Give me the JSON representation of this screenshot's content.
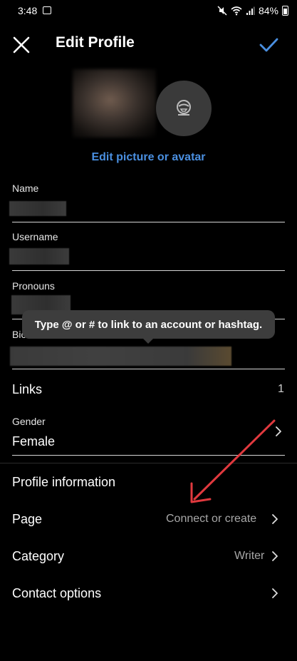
{
  "status_bar": {
    "time": "3:48",
    "battery": "84%"
  },
  "header": {
    "title": "Edit Profile"
  },
  "avatar": {
    "edit_link": "Edit picture or avatar"
  },
  "fields": {
    "name_label": "Name",
    "username_label": "Username",
    "pronouns_label": "Pronouns",
    "bio_label": "Bio"
  },
  "tooltip": {
    "text": "Type @ or # to link to an account or hashtag."
  },
  "links": {
    "label": "Links",
    "count": "1"
  },
  "gender": {
    "label": "Gender",
    "value": "Female"
  },
  "profile_information": {
    "title": "Profile information"
  },
  "page_row": {
    "label": "Page",
    "value": "Connect or create"
  },
  "category_row": {
    "label": "Category",
    "value": "Writer"
  },
  "contact_row": {
    "label": "Contact options"
  },
  "colors": {
    "background": "#000000",
    "accent_blue": "#4a8fe0",
    "annotation_arrow": "#e0393e"
  }
}
